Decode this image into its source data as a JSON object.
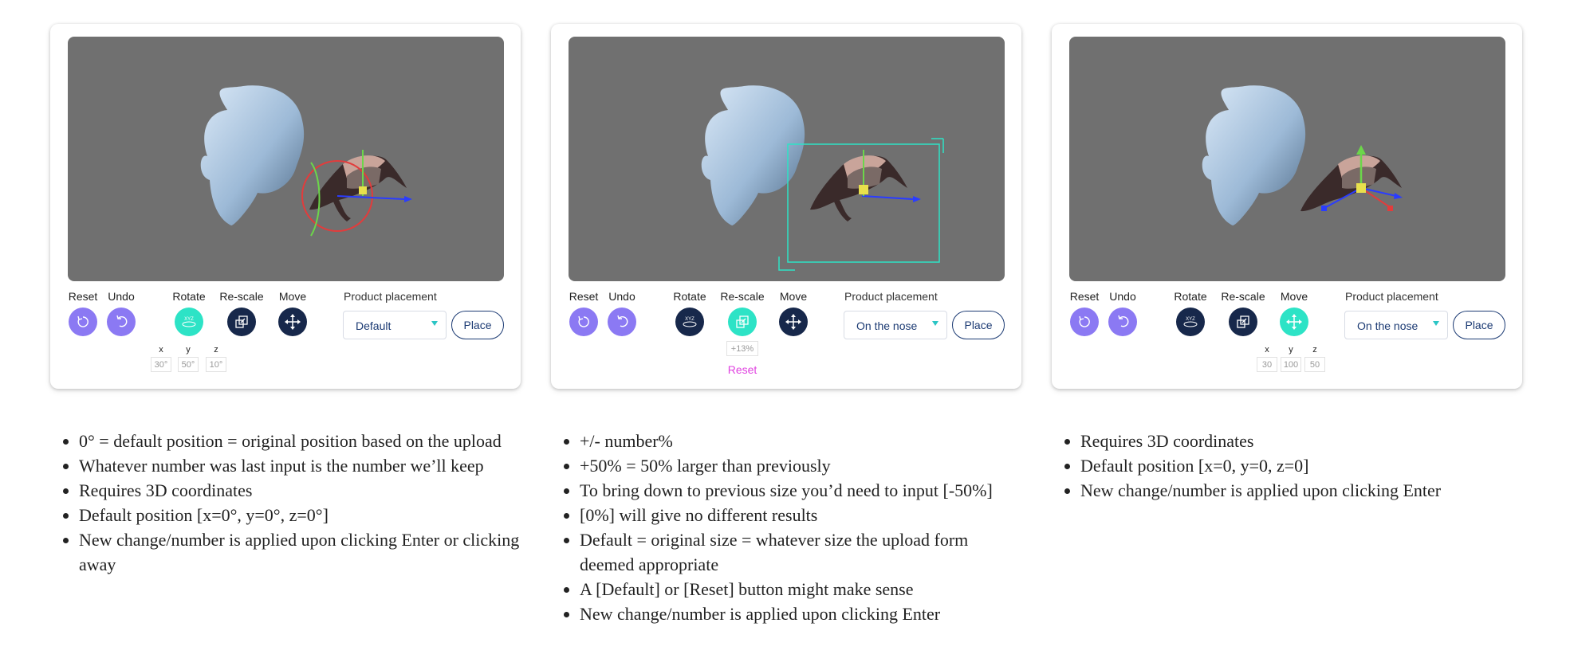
{
  "panels": [
    {
      "tools": {
        "reset": "Reset",
        "undo": "Undo",
        "rotate": "Rotate",
        "rescale": "Re-scale",
        "move": "Move"
      },
      "rotate_icon_text": "XYZ",
      "product_placement_label": "Product placement",
      "placement_value": "Default",
      "place_label": "Place",
      "active_tool": "rotate",
      "gizmo": "rotate",
      "coords": {
        "x_label": "x",
        "y_label": "y",
        "z_label": "z",
        "x": "30°",
        "y": "50°",
        "z": "10°"
      }
    },
    {
      "tools": {
        "reset": "Reset",
        "undo": "Undo",
        "rotate": "Rotate",
        "rescale": "Re-scale",
        "move": "Move"
      },
      "rotate_icon_text": "XYZ",
      "product_placement_label": "Product placement",
      "placement_value": "On the nose",
      "place_label": "Place",
      "active_tool": "rescale",
      "gizmo": "scale",
      "scale_value": "+13%",
      "reset_link": "Reset"
    },
    {
      "tools": {
        "reset": "Reset",
        "undo": "Undo",
        "rotate": "Rotate",
        "rescale": "Re-scale",
        "move": "Move"
      },
      "rotate_icon_text": "XYZ",
      "product_placement_label": "Product placement",
      "placement_value": "On the nose",
      "place_label": "Place",
      "active_tool": "move",
      "gizmo": "move",
      "coords": {
        "x_label": "x",
        "y_label": "y",
        "z_label": "z",
        "x": "30",
        "y": "100",
        "z": "50"
      }
    }
  ],
  "notes": [
    [
      "0° = default position = original position based on the upload",
      "Whatever number was last input is the number we’ll keep",
      "Requires 3D coordinates",
      "Default position [x=0°, y=0°, z=0°]",
      "New change/number is applied upon clicking Enter or clicking away"
    ],
    [
      "+/- number%",
      "+50% = 50% larger than previously",
      "To bring down to previous size you’d need to input [-50%]",
      "[0%] will give no different results",
      "Default = original size = whatever size the upload form deemed appropriate",
      "A [Default] or [Reset] button might make sense",
      "New change/number is applied upon clicking Enter"
    ],
    [
      "Requires 3D coordinates",
      "Default position [x=0, y=0, z=0]",
      "New change/number is applied upon clicking Enter"
    ]
  ],
  "colors": {
    "viewport": "#707070",
    "purple_button": "#8b79f3",
    "navy_button": "#17284b",
    "teal_button": "#2de3c6",
    "select_text": "#1b3a73",
    "reset_link": "#e042e0",
    "scale_box": "#2de3c6"
  }
}
